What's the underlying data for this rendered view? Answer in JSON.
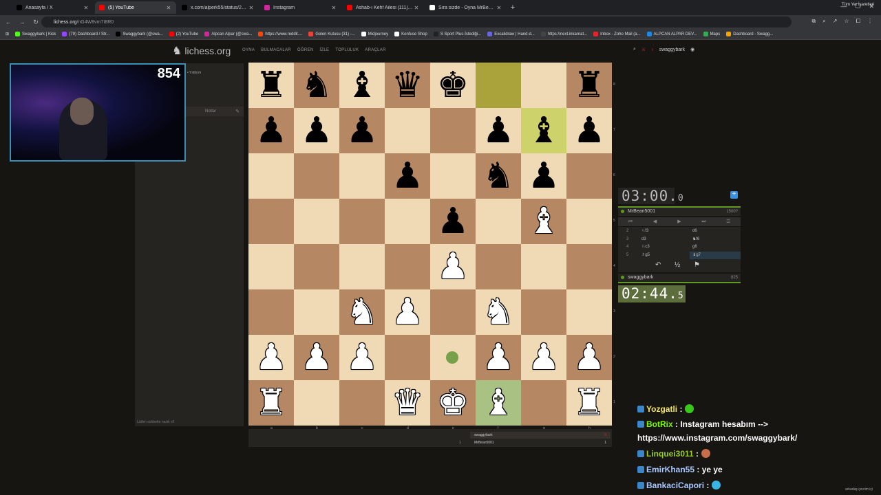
{
  "tabs": [
    {
      "label": "Anasayfa / X",
      "fav": "x",
      "color": "#000000",
      "active": false
    },
    {
      "label": "(5) YouTube",
      "fav": "yt",
      "color": "#ff0000",
      "active": true
    },
    {
      "label": "x.com/alperk55/status/200989...",
      "fav": "x",
      "color": "#000000",
      "active": false
    },
    {
      "label": "Instagram",
      "fav": "ig",
      "color": "#d6249f",
      "active": false
    },
    {
      "label": "Ashab-ı Kehf Ailesi [111] - bayl...",
      "fav": "yt",
      "color": "#ff0000",
      "active": false
    },
    {
      "label": "Sıra sizde - Oyna MrBean5001",
      "fav": "lichess",
      "color": "#ffffff",
      "active": false
    }
  ],
  "newtab": "+",
  "address": {
    "host": "lichess.org",
    "path": "/nG4W8vm7I8R0"
  },
  "bookmarks": [
    {
      "label": "Swaggybark | Kick",
      "color": "#53fc18"
    },
    {
      "label": "(79) Dashboard / Str...",
      "color": "#9146ff"
    },
    {
      "label": "Swaggybark (@swa...",
      "color": "#000000"
    },
    {
      "label": "(2) YouTube",
      "color": "#ff0000"
    },
    {
      "label": "Alpcan Alpar (@swa...",
      "color": "#d6249f"
    },
    {
      "label": "https://www.reddit....",
      "color": "#ff4500"
    },
    {
      "label": "Gelen Kutusu (31) -...",
      "color": "#ea4335"
    },
    {
      "label": "Midjourney",
      "color": "#ffffff"
    },
    {
      "label": "Konfuse Shop",
      "color": "#ffffff"
    },
    {
      "label": "S Sport Plus-İstediği...",
      "color": "#222222"
    },
    {
      "label": "Excalidraw | Hand-d...",
      "color": "#6965db"
    },
    {
      "label": "https://next.inkarnat...",
      "color": "#444444"
    },
    {
      "label": "Inbox - Zoho Mail (a...",
      "color": "#e42527"
    },
    {
      "label": "ALPCAN ALPAR DEV...",
      "color": "#1e88e5"
    },
    {
      "label": "Maps",
      "color": "#34a853"
    },
    {
      "label": "Dashboard - Swagg...",
      "color": "#f4a300"
    }
  ],
  "bookmarks_all": "Tüm Yer İşaretleri",
  "lichess": {
    "logo": "lichess.org",
    "nav": [
      "OYNA",
      "BULMACALAR",
      "ÖĞREN",
      "İZLE",
      "TOPLULUK",
      "ARAÇLAR"
    ],
    "user": "swaggybark"
  },
  "cam_counter": "854",
  "left": {
    "title": "• Yıldırım",
    "notes": "Notlar",
    "chat_placeholder": "Lütfen sohbette nazik ol!"
  },
  "files": [
    "a",
    "b",
    "c",
    "d",
    "e",
    "f",
    "g",
    "h"
  ],
  "ranks": [
    "8",
    "7",
    "6",
    "5",
    "4",
    "3",
    "2",
    "1"
  ],
  "board": [
    [
      "bR",
      "bN",
      "bB",
      "bQ",
      "bK",
      "",
      "",
      "bR"
    ],
    [
      "bP",
      "bP",
      "bP",
      "",
      "",
      "bP",
      "bB",
      "bP"
    ],
    [
      "",
      "",
      "",
      "bP",
      "",
      "bN",
      "bP",
      ""
    ],
    [
      "",
      "",
      "",
      "",
      "bP",
      "",
      "wB",
      ""
    ],
    [
      "",
      "",
      "",
      "",
      "wP",
      "",
      "",
      ""
    ],
    [
      "",
      "",
      "wN",
      "wP",
      "",
      "wN",
      "",
      ""
    ],
    [
      "wP",
      "wP",
      "wP",
      "",
      "",
      "wP",
      "wP",
      "wP"
    ],
    [
      "wR",
      "",
      "",
      "wQ",
      "wK",
      "wB",
      "",
      "wR"
    ]
  ],
  "game": {
    "top_clock": {
      "main": "03:00",
      "tenths": "0"
    },
    "opponent": {
      "name": "MrBean5001",
      "rating": "1500?"
    },
    "me": {
      "name": "swaggybark",
      "rating": "825"
    },
    "bottom_clock": {
      "main": "02:44",
      "tenths": "5"
    },
    "moves": [
      {
        "n": "2",
        "w": "♘f3",
        "b": "d6"
      },
      {
        "n": "3",
        "w": "d3",
        "b": "♞f6"
      },
      {
        "n": "4",
        "w": "♘c3",
        "b": "g6"
      },
      {
        "n": "5",
        "w": "♗g5",
        "b": "♝g7"
      }
    ],
    "controls": [
      "⏮",
      "◀",
      "▶",
      "⏭",
      "☰"
    ],
    "actions": {
      "takeback": "↶",
      "draw": "½",
      "resign": "⚑"
    }
  },
  "table": {
    "p1": "swaggybark",
    "p2": "MrBean5001",
    "num": "1",
    "d1": "0",
    "d2": "1"
  },
  "chat": [
    {
      "name": "Yozgatli",
      "msg": " :",
      "name_color": "#f5e663",
      "emote": "#39c91b"
    },
    {
      "name": "BotRix",
      "msg": " : Instagram hesabım -->",
      "name_color": "#7cfc00",
      "emote": ""
    },
    {
      "name": "",
      "msg": "https://www.instagram.com/swaggybark/",
      "name_color": "#ffffff",
      "emote": ""
    },
    {
      "name": "Linquei3011",
      "msg": " :",
      "name_color": "#9acd32",
      "emote": "#c86d4a"
    },
    {
      "name": "EmirKhan55",
      "msg": " : ye ye",
      "name_color": "#a8c8ff",
      "emote": ""
    },
    {
      "name": "BankaciCapori",
      "msg": " :",
      "name_color": "#a8c8ff",
      "emote": "#39b4e3"
    }
  ],
  "footer": "arkadaş çevrim içi"
}
